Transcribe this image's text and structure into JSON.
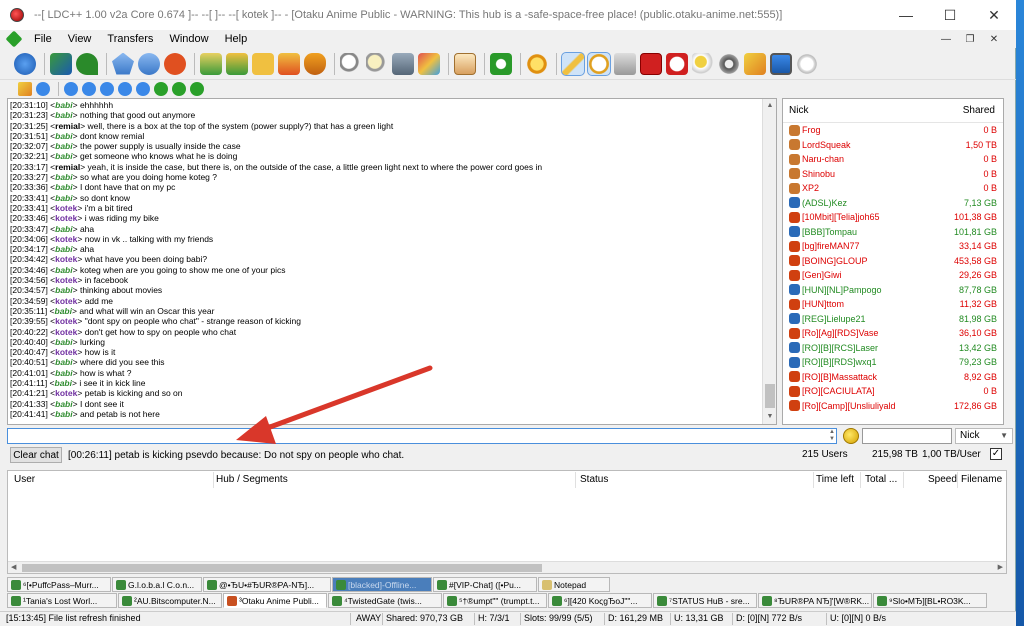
{
  "window": {
    "title": "--[ LDC++ 1.00 v2a Core 0.674 ]-- --[ ]-- --[ kotek ]-- - [Otaku Anime Public - WARNING: This hub is a -safe-space-free place! (public.otaku-anime.net:555)]",
    "minimize": "—",
    "maximize": "☐",
    "close": "✕"
  },
  "menu": {
    "items": [
      "File",
      "View",
      "Transfers",
      "Window",
      "Help"
    ],
    "mdi_min": "—",
    "mdi_restore": "❐",
    "mdi_close": "✕"
  },
  "chat": {
    "lines": [
      {
        "time": "[20:31:10]",
        "nick": "babi",
        "style": "g",
        "text": "ehhhhhh"
      },
      {
        "time": "[20:31:23]",
        "nick": "babi",
        "style": "g",
        "text": "nothing that good out anymore"
      },
      {
        "time": "[20:31:25]",
        "nick": "remial",
        "style": "b",
        "text": "well, there is a box at the top of the system (power supply?) that has a green light"
      },
      {
        "time": "[20:31:51]",
        "nick": "babi",
        "style": "g",
        "text": "dont know remial"
      },
      {
        "time": "[20:32:07]",
        "nick": "babi",
        "style": "g",
        "text": "the power supply is usually inside the case"
      },
      {
        "time": "[20:32:21]",
        "nick": "babi",
        "style": "g",
        "text": "get someone who knows what he is doing"
      },
      {
        "time": "[20:33:17]",
        "nick": "remial",
        "style": "b",
        "text": "yeah, it is inside the case, but there is, on the outside of the case, a little green light next to where the power cord goes in"
      },
      {
        "time": "[20:33:27]",
        "nick": "babi",
        "style": "g",
        "text": "so what are you doing home koteg ?"
      },
      {
        "time": "[20:33:36]",
        "nick": "babi",
        "style": "g",
        "text": "I dont have that on my pc"
      },
      {
        "time": "[20:33:41]",
        "nick": "babi",
        "style": "g",
        "text": "so dont know"
      },
      {
        "time": "[20:33:41]",
        "nick": "kotek",
        "style": "p",
        "text": "i'm a bit tired"
      },
      {
        "time": "[20:33:46]",
        "nick": "kotek",
        "style": "p",
        "text": "i was riding my bike"
      },
      {
        "time": "[20:33:47]",
        "nick": "babi",
        "style": "g",
        "text": "aha"
      },
      {
        "time": "[20:34:06]",
        "nick": "kotek",
        "style": "p",
        "text": "now in vk .. talking with my friends"
      },
      {
        "time": "[20:34:17]",
        "nick": "babi",
        "style": "g",
        "text": "   aha"
      },
      {
        "time": "[20:34:42]",
        "nick": "kotek",
        "style": "p",
        "text": "what have you been doing babi?"
      },
      {
        "time": "[20:34:46]",
        "nick": "babi",
        "style": "g",
        "text": "koteg when are you going to show me one of your pics"
      },
      {
        "time": "[20:34:56]",
        "nick": "kotek",
        "style": "p",
        "text": "in facebook"
      },
      {
        "time": "[20:34:57]",
        "nick": "babi",
        "style": "g",
        "text": "thinking about movies"
      },
      {
        "time": "[20:34:59]",
        "nick": "kotek",
        "style": "p",
        "text": "add me"
      },
      {
        "time": "[20:35:11]",
        "nick": "babi",
        "style": "g",
        "text": "and what will win an Oscar this year"
      },
      {
        "time": "[20:39:55]",
        "nick": "kotek",
        "style": "p",
        "text": "\"dont spy on people who chat\" - strange reason of kicking"
      },
      {
        "time": "[20:40:22]",
        "nick": "kotek",
        "style": "p",
        "text": "don't get how to spy on people who chat"
      },
      {
        "time": "[20:40:40]",
        "nick": "babi",
        "style": "g",
        "text": "lurking"
      },
      {
        "time": "[20:40:47]",
        "nick": "kotek",
        "style": "p",
        "text": "how is it"
      },
      {
        "time": "[20:40:51]",
        "nick": "babi",
        "style": "g",
        "text": "where did you see this"
      },
      {
        "time": "[20:41:01]",
        "nick": "babi",
        "style": "g",
        "text": "how is what ?"
      },
      {
        "time": "[20:41:11]",
        "nick": "babi",
        "style": "g",
        "text": "i see it in kick line"
      },
      {
        "time": "[20:41:21]",
        "nick": "kotek",
        "style": "p",
        "text": "petab is kicking and so on"
      },
      {
        "time": "[20:41:33]",
        "nick": "babi",
        "style": "g",
        "text": "I dont see it"
      },
      {
        "time": "[20:41:41]",
        "nick": "babi",
        "style": "g",
        "text": "and petab is not here"
      }
    ],
    "input_value": ""
  },
  "userlist": {
    "col_nick": "Nick",
    "col_shared": "Shared",
    "users": [
      {
        "nick": "Frog",
        "shared": "0 B",
        "c": "r",
        "icon": "#c87830"
      },
      {
        "nick": "LordSqueak",
        "shared": "1,50 TB",
        "c": "r",
        "icon": "#c87830"
      },
      {
        "nick": "Naru-chan",
        "shared": "0 B",
        "c": "r",
        "icon": "#c87830"
      },
      {
        "nick": "Shinobu",
        "shared": "0 B",
        "c": "r",
        "icon": "#c87830"
      },
      {
        "nick": "XP2",
        "shared": "0 B",
        "c": "r",
        "icon": "#c87830"
      },
      {
        "nick": "(ADSL)Kez",
        "shared": "7,13 GB",
        "c": "g",
        "icon": "#2a6ab8"
      },
      {
        "nick": "[10Mbit][Telia]joh65",
        "shared": "101,38 GB",
        "c": "r",
        "icon": "#d04010"
      },
      {
        "nick": "[BBB]Tompau",
        "shared": "101,81 GB",
        "c": "g",
        "icon": "#2a6ab8"
      },
      {
        "nick": "[bg]fireMAN77",
        "shared": "33,14 GB",
        "c": "r",
        "icon": "#d04010"
      },
      {
        "nick": "[BOING]GLOUP",
        "shared": "453,58 GB",
        "c": "r",
        "icon": "#d04010"
      },
      {
        "nick": "[Gen]Giwi",
        "shared": "29,26 GB",
        "c": "r",
        "icon": "#d04010"
      },
      {
        "nick": "[HUN][NL]Pampogo",
        "shared": "87,78 GB",
        "c": "g",
        "icon": "#2a6ab8"
      },
      {
        "nick": "[HUN]ttom",
        "shared": "11,32 GB",
        "c": "r",
        "icon": "#d04010"
      },
      {
        "nick": "[REG]Lielupe21",
        "shared": "81,98 GB",
        "c": "g",
        "icon": "#2a6ab8"
      },
      {
        "nick": "[Ro][Ag][RDS]Vase",
        "shared": "36,10 GB",
        "c": "r",
        "icon": "#d04010"
      },
      {
        "nick": "[RO][B][RCS]Laser",
        "shared": "13,42 GB",
        "c": "g",
        "icon": "#2a6ab8"
      },
      {
        "nick": "[RO][B][RDS]wxq1",
        "shared": "79,23 GB",
        "c": "g",
        "icon": "#2a6ab8"
      },
      {
        "nick": "[RO][B]Massattack",
        "shared": "8,92 GB",
        "c": "r",
        "icon": "#d04010"
      },
      {
        "nick": "[RO][CACIULATA]",
        "shared": "0 B",
        "c": "r",
        "icon": "#d04010"
      },
      {
        "nick": "[Ro][Camp][Unsliuliyald",
        "shared": "172,86 GB",
        "c": "r",
        "icon": "#d04010"
      }
    ]
  },
  "inputbar": {
    "search_value": "",
    "nick_select": "Nick",
    "dropdown_arrow": "▼"
  },
  "statusline": {
    "clear_button": "Clear chat",
    "message": "[00:26:11] petab is kicking psevdo because: Do not spy on people who chat.",
    "users": "215 Users",
    "total_share": "215,98 TB",
    "per_user": "1,00 TB/User",
    "checkbox": "✓"
  },
  "transfers": {
    "columns": [
      "User",
      "Hub / Segments",
      "Status",
      "Time left",
      "Total ...",
      "Speed",
      "Filename"
    ]
  },
  "tabs_row1": [
    {
      "label": "⁶[•PuffcPass–Murr...",
      "icon": "#3a8a3a"
    },
    {
      "label": "G.l.o.b.a.l C.o.n...",
      "icon": "#3a8a3a"
    },
    {
      "label": "@•ЂU•#ЂUR®PA-NЂ]...",
      "icon": "#3a8a3a"
    },
    {
      "label": "[blacked]-Offline...",
      "icon": "#3a8a3a",
      "hl": true
    },
    {
      "label": "#[VIP-Chat] ([•Pu...",
      "icon": "#3a8a3a"
    },
    {
      "label": "Notepad",
      "icon": "#d8c070"
    }
  ],
  "tabs_row2": [
    {
      "label": "¹Tania's Lost Worl...",
      "icon": "#3a8a3a"
    },
    {
      "label": "²AU.Bitscomputer.N...",
      "icon": "#3a8a3a"
    },
    {
      "label": "³Otaku Anime Publi...",
      "icon": "#c85020",
      "active": true
    },
    {
      "label": "⁴TwistedGate (twis...",
      "icon": "#3a8a3a"
    },
    {
      "label": "⁵†®umpt\"\" (trumpt.t...",
      "icon": "#3a8a3a"
    },
    {
      "label": "⁶][420 KoςgЂoJ\"\"...",
      "icon": "#3a8a3a"
    },
    {
      "label": "⁷STATUS HuB - sre...",
      "icon": "#3a8a3a"
    },
    {
      "label": "⁸ЂUR®PA NЂ]'[W®RK...",
      "icon": "#3a8a3a"
    },
    {
      "label": "⁹Slo•MЂ][BL•RO3K...",
      "icon": "#3a8a3a"
    }
  ],
  "statusbar": {
    "log": "[15:13:45] File list refresh finished",
    "away": "AWAY",
    "shared": "Shared: 970,73 GB",
    "hubs": "H: 7/3/1",
    "slots": "Slots: 99/99 (5/5)",
    "download_total": "D: 161,29 MB",
    "upload_total": "U: 13,31 GB",
    "download_rate": "D: [0][N] 772 B/s",
    "upload_rate": "U: [0][N] 0 B/s"
  },
  "colors": {
    "accent": "#4a8fdc",
    "arrow": "#d9372a",
    "share_red": "#cc0000",
    "nick_green": "#2e8b2e",
    "nick_purple": "#7030a0"
  }
}
